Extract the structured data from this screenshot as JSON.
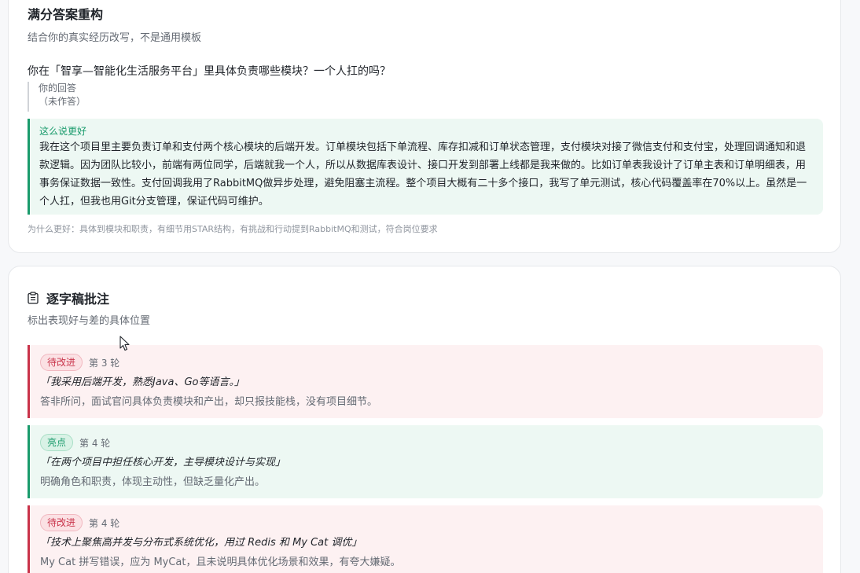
{
  "rewrite": {
    "title": "满分答案重构",
    "subtitle": "结合你的真实经历改写，不是通用模板",
    "question": "你在「智享—智能化生活服务平台」里具体负责哪些模块？一个人扛的吗？",
    "your_answer_label": "你的回答",
    "your_answer_value": "（未作答）",
    "better_label": "这么说更好",
    "better_text": "我在这个项目里主要负责订单和支付两个核心模块的后端开发。订单模块包括下单流程、库存扣减和订单状态管理，支付模块对接了微信支付和支付宝，处理回调通知和退款逻辑。因为团队比较小，前端有两位同学，后端就我一个人，所以从数据库表设计、接口开发到部署上线都是我来做的。比如订单表我设计了订单主表和订单明细表，用事务保证数据一致性。支付回调我用了RabbitMQ做异步处理，避免阻塞主流程。整个项目大概有二十多个接口，我写了单元测试，核心代码覆盖率在70%以上。虽然是一个人扛，但我也用Git分支管理，保证代码可维护。",
    "why_text": "为什么更好：具体到模块和职责，有细节用STAR结构，有挑战和行动提到RabbitMQ和测试，符合岗位要求"
  },
  "annotations": {
    "title": "逐字稿批注",
    "subtitle": "标出表现好与差的具体位置",
    "icon": "clipboard-icon",
    "items": [
      {
        "type": "bad",
        "badge": "待改进",
        "round": "第 3 轮",
        "quote": "「我采用后端开发，熟悉Java、Go等语言。」",
        "comment": "答非所问，面试官问具体负责模块和产出，却只报技能栈，没有项目细节。"
      },
      {
        "type": "good",
        "badge": "亮点",
        "round": "第 4 轮",
        "quote": "「在两个项目中担任核心开发，主导模块设计与实现」",
        "comment": "明确角色和职责，体现主动性，但缺乏量化产出。"
      },
      {
        "type": "bad",
        "badge": "待改进",
        "round": "第 4 轮",
        "quote": "「技术上聚焦高并发与分布式系统优化，用过 Redis 和 My Cat 调优」",
        "comment": "My Cat 拼写错误，应为 MyCat，且未说明具体优化场景和效果，有夸大嫌疑。"
      }
    ]
  },
  "colors": {
    "bad_accent": "#c9334a",
    "good_accent": "#1a9b6c"
  }
}
